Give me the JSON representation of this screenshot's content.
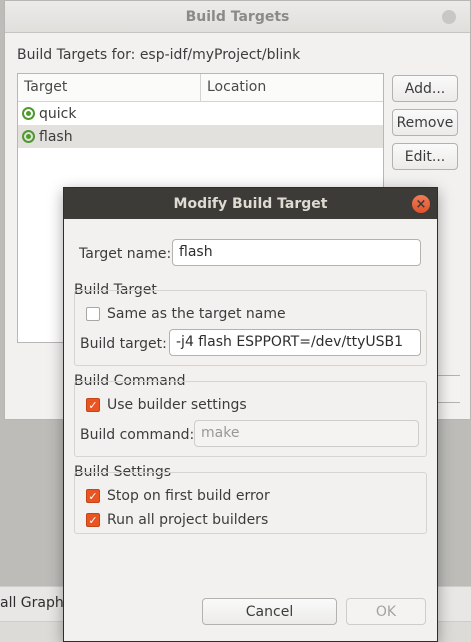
{
  "build_targets": {
    "title": "Build Targets",
    "heading": "Build Targets for: esp-idf/myProject/blink",
    "columns": [
      "Target",
      "Location"
    ],
    "rows": [
      {
        "name": "quick",
        "location": ""
      },
      {
        "name": "flash",
        "location": ""
      }
    ],
    "buttons": {
      "add": "Add...",
      "remove": "Remove",
      "edit": "Edit..."
    }
  },
  "ide": {
    "bottom_tab": "all Graph"
  },
  "modify": {
    "title": "Modify Build Target",
    "close_glyph": "×",
    "target_name_label": "Target name:",
    "target_name_value": "flash",
    "build_target_group": "Build Target",
    "same_as_target_label": "Same as the target name",
    "same_as_target_checked": false,
    "build_target_label": "Build target:",
    "build_target_value": "-j4 flash  ESPPORT=/dev/ttyUSB1",
    "build_command_group": "Build Command",
    "use_builder_label": "Use builder settings",
    "use_builder_checked": true,
    "build_command_label": "Build command:",
    "build_command_value": "make",
    "build_settings_group": "Build Settings",
    "stop_on_error_label": "Stop on first build error",
    "stop_on_error_checked": true,
    "run_all_label": "Run all project builders",
    "run_all_checked": true,
    "cancel_label": "Cancel",
    "ok_label": "OK"
  },
  "colors": {
    "accent_orange": "#e95420",
    "dark_titlebar": "#3c3b37",
    "status_green": "#4e9a2e"
  }
}
